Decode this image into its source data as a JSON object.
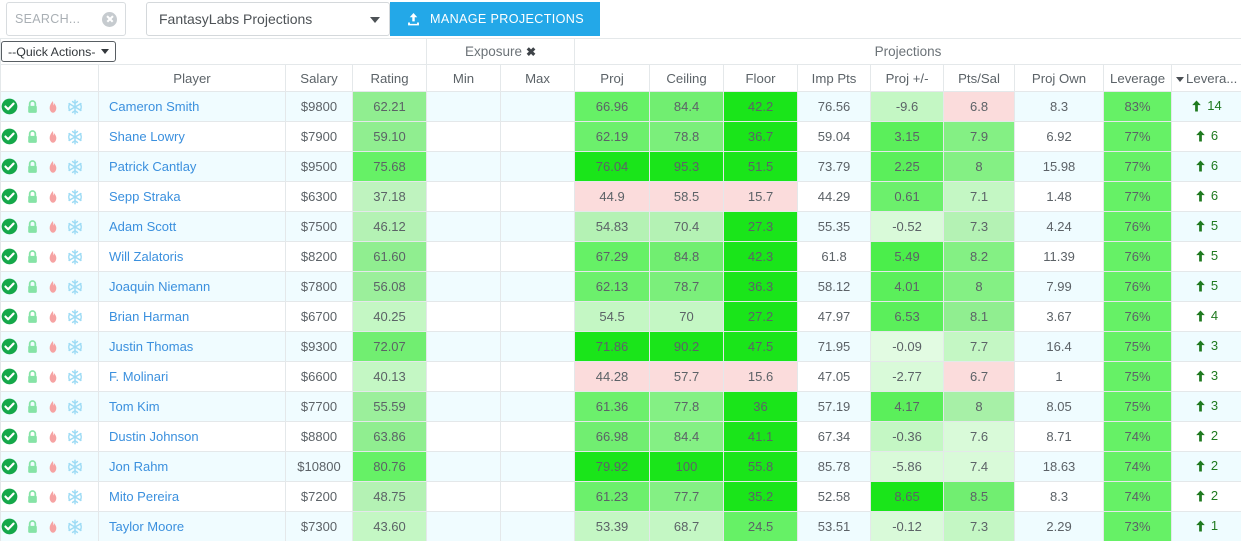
{
  "toolbar": {
    "search_placeholder": "SEARCH...",
    "clear_icon": "clear-circle-icon",
    "projection_source": "FantasyLabs Projections",
    "manage_button": "MANAGE PROJECTIONS",
    "upload_icon": "upload-icon"
  },
  "grid": {
    "quick_actions_label": "--Quick Actions-",
    "group_headers": [
      {
        "label": "Exposure",
        "close": "✖"
      },
      {
        "label": "Projections"
      }
    ],
    "columns": [
      "",
      "Player",
      "Salary",
      "Rating",
      "Min",
      "Max",
      "Proj",
      "Ceiling",
      "Floor",
      "Imp Pts",
      "Proj +/-",
      "Pts/Sal",
      "Proj Own",
      "Leverage",
      "Levera..."
    ],
    "sorted_column": "Levera...",
    "sort_direction": "desc",
    "row_icons": [
      "check-circle-icon",
      "lock-icon",
      "flame-icon",
      "snowflake-icon"
    ],
    "rows": [
      {
        "player": "Cameron Smith",
        "salary": "$9800",
        "rating": "62.21",
        "min": "",
        "max": "",
        "proj": "66.96",
        "ceiling": "84.4",
        "floor": "42.2",
        "imp_pts": "76.56",
        "proj_pm": "-9.6",
        "pts_sal": "6.8",
        "proj_own": "8.3",
        "leverage": "83%",
        "lev_rank": "14",
        "c": {
          "rating": "#90ee90",
          "proj": "#66f166",
          "ceiling": "#71ee71",
          "floor": "#1ae51a",
          "imp_pts": "#effcff",
          "proj_pm": "#c4f7c4",
          "pts_sal": "#fbdcdc",
          "proj_own": "#effcff",
          "leverage": "#66f166",
          "lev_rank": "#effcff"
        }
      },
      {
        "player": "Shane Lowry",
        "salary": "$7900",
        "rating": "59.10",
        "min": "",
        "max": "",
        "proj": "62.19",
        "ceiling": "78.8",
        "floor": "36.7",
        "imp_pts": "59.04",
        "proj_pm": "3.15",
        "pts_sal": "7.9",
        "proj_own": "6.92",
        "leverage": "77%",
        "lev_rank": "6",
        "c": {
          "rating": "#90ee90",
          "proj": "#6cf06c",
          "ceiling": "#7bef7b",
          "floor": "#1ae51a",
          "imp_pts": "#ffffff",
          "proj_pm": "#5bef5b",
          "pts_sal": "#84f084",
          "proj_own": "#ffffff",
          "leverage": "#66f166",
          "lev_rank": "#ffffff"
        }
      },
      {
        "player": "Patrick Cantlay",
        "salary": "$9500",
        "rating": "75.68",
        "min": "",
        "max": "",
        "proj": "76.04",
        "ceiling": "95.3",
        "floor": "51.5",
        "imp_pts": "73.79",
        "proj_pm": "2.25",
        "pts_sal": "8",
        "proj_own": "15.98",
        "leverage": "77%",
        "lev_rank": "6",
        "c": {
          "rating": "#66f166",
          "proj": "#1ae51a",
          "ceiling": "#1ae51a",
          "floor": "#1ae51a",
          "imp_pts": "#effcff",
          "proj_pm": "#5bef5b",
          "pts_sal": "#84f084",
          "proj_own": "#effcff",
          "leverage": "#66f166",
          "lev_rank": "#effcff"
        }
      },
      {
        "player": "Sepp Straka",
        "salary": "$6300",
        "rating": "37.18",
        "min": "",
        "max": "",
        "proj": "44.9",
        "ceiling": "58.5",
        "floor": "15.7",
        "imp_pts": "44.29",
        "proj_pm": "0.61",
        "pts_sal": "7.1",
        "proj_own": "1.48",
        "leverage": "77%",
        "lev_rank": "6",
        "c": {
          "rating": "#bff3bf",
          "proj": "#fbdcdc",
          "ceiling": "#fbdcdc",
          "floor": "#fbdcdc",
          "imp_pts": "#ffffff",
          "proj_pm": "#6cf06c",
          "pts_sal": "#c4f7c4",
          "proj_own": "#ffffff",
          "leverage": "#66f166",
          "lev_rank": "#ffffff"
        }
      },
      {
        "player": "Adam Scott",
        "salary": "$7500",
        "rating": "46.12",
        "min": "",
        "max": "",
        "proj": "54.83",
        "ceiling": "70.4",
        "floor": "27.3",
        "imp_pts": "55.35",
        "proj_pm": "-0.52",
        "pts_sal": "7.3",
        "proj_own": "4.24",
        "leverage": "76%",
        "lev_rank": "5",
        "c": {
          "rating": "#b4f2b4",
          "proj": "#b4f2b4",
          "ceiling": "#b4f2b4",
          "floor": "#1ae51a",
          "imp_pts": "#effcff",
          "proj_pm": "#d9fad9",
          "pts_sal": "#b4f2b4",
          "proj_own": "#effcff",
          "leverage": "#66f166",
          "lev_rank": "#effcff"
        }
      },
      {
        "player": "Will Zalatoris",
        "salary": "$8200",
        "rating": "61.60",
        "min": "",
        "max": "",
        "proj": "67.29",
        "ceiling": "84.8",
        "floor": "42.3",
        "imp_pts": "61.8",
        "proj_pm": "5.49",
        "pts_sal": "8.2",
        "proj_own": "11.39",
        "leverage": "76%",
        "lev_rank": "5",
        "c": {
          "rating": "#90ee90",
          "proj": "#66f166",
          "ceiling": "#71ee71",
          "floor": "#1ae51a",
          "imp_pts": "#ffffff",
          "proj_pm": "#4bee4b",
          "pts_sal": "#84f084",
          "proj_own": "#ffffff",
          "leverage": "#66f166",
          "lev_rank": "#ffffff"
        }
      },
      {
        "player": "Joaquin Niemann",
        "salary": "$7800",
        "rating": "56.08",
        "min": "",
        "max": "",
        "proj": "62.13",
        "ceiling": "78.7",
        "floor": "36.3",
        "imp_pts": "58.12",
        "proj_pm": "4.01",
        "pts_sal": "8",
        "proj_own": "7.99",
        "leverage": "76%",
        "lev_rank": "5",
        "c": {
          "rating": "#9bef9b",
          "proj": "#6cf06c",
          "ceiling": "#7bef7b",
          "floor": "#1ae51a",
          "imp_pts": "#effcff",
          "proj_pm": "#5bef5b",
          "pts_sal": "#84f084",
          "proj_own": "#effcff",
          "leverage": "#66f166",
          "lev_rank": "#effcff"
        }
      },
      {
        "player": "Brian Harman",
        "salary": "$6700",
        "rating": "40.25",
        "min": "",
        "max": "",
        "proj": "54.5",
        "ceiling": "70",
        "floor": "27.2",
        "imp_pts": "47.97",
        "proj_pm": "6.53",
        "pts_sal": "8.1",
        "proj_own": "3.67",
        "leverage": "76%",
        "lev_rank": "4",
        "c": {
          "rating": "#c4f7c4",
          "proj": "#c4f7c4",
          "ceiling": "#c4f7c4",
          "floor": "#1ae51a",
          "imp_pts": "#ffffff",
          "proj_pm": "#5bef5b",
          "pts_sal": "#90ee90",
          "proj_own": "#ffffff",
          "leverage": "#66f166",
          "lev_rank": "#ffffff"
        }
      },
      {
        "player": "Justin Thomas",
        "salary": "$9300",
        "rating": "72.07",
        "min": "",
        "max": "",
        "proj": "71.86",
        "ceiling": "90.2",
        "floor": "47.5",
        "imp_pts": "71.95",
        "proj_pm": "-0.09",
        "pts_sal": "7.7",
        "proj_own": "16.4",
        "leverage": "75%",
        "lev_rank": "3",
        "c": {
          "rating": "#71ee71",
          "proj": "#1ae51a",
          "ceiling": "#1ae51a",
          "floor": "#1ae51a",
          "imp_pts": "#effcff",
          "proj_pm": "#e2fbe2",
          "pts_sal": "#c4f7c4",
          "proj_own": "#effcff",
          "leverage": "#66f166",
          "lev_rank": "#effcff"
        }
      },
      {
        "player": "F. Molinari",
        "salary": "$6600",
        "rating": "40.13",
        "min": "",
        "max": "",
        "proj": "44.28",
        "ceiling": "57.7",
        "floor": "15.6",
        "imp_pts": "47.05",
        "proj_pm": "-2.77",
        "pts_sal": "6.7",
        "proj_own": "1",
        "leverage": "75%",
        "lev_rank": "3",
        "c": {
          "rating": "#c4f7c4",
          "proj": "#fbdcdc",
          "ceiling": "#fbdcdc",
          "floor": "#fbdcdc",
          "imp_pts": "#ffffff",
          "proj_pm": "#d9fad9",
          "pts_sal": "#fbdcdc",
          "proj_own": "#ffffff",
          "leverage": "#66f166",
          "lev_rank": "#ffffff"
        }
      },
      {
        "player": "Tom Kim",
        "salary": "$7700",
        "rating": "55.59",
        "min": "",
        "max": "",
        "proj": "61.36",
        "ceiling": "77.8",
        "floor": "36",
        "imp_pts": "57.19",
        "proj_pm": "4.17",
        "pts_sal": "8",
        "proj_own": "8.05",
        "leverage": "75%",
        "lev_rank": "3",
        "c": {
          "rating": "#9bef9b",
          "proj": "#6cf06c",
          "ceiling": "#84f084",
          "floor": "#1ae51a",
          "imp_pts": "#effcff",
          "proj_pm": "#5bef5b",
          "pts_sal": "#a7f0a7",
          "proj_own": "#effcff",
          "leverage": "#66f166",
          "lev_rank": "#effcff"
        }
      },
      {
        "player": "Dustin Johnson",
        "salary": "$8800",
        "rating": "63.86",
        "min": "",
        "max": "",
        "proj": "66.98",
        "ceiling": "84.4",
        "floor": "41.1",
        "imp_pts": "67.34",
        "proj_pm": "-0.36",
        "pts_sal": "7.6",
        "proj_own": "8.71",
        "leverage": "74%",
        "lev_rank": "2",
        "c": {
          "rating": "#90ee90",
          "proj": "#71ee71",
          "ceiling": "#84f084",
          "floor": "#1ae51a",
          "imp_pts": "#ffffff",
          "proj_pm": "#c4f7c4",
          "pts_sal": "#d9fad9",
          "proj_own": "#ffffff",
          "leverage": "#66f166",
          "lev_rank": "#ffffff"
        }
      },
      {
        "player": "Jon Rahm",
        "salary": "$10800",
        "rating": "80.76",
        "min": "",
        "max": "",
        "proj": "79.92",
        "ceiling": "100",
        "floor": "55.8",
        "imp_pts": "85.78",
        "proj_pm": "-5.86",
        "pts_sal": "7.4",
        "proj_own": "18.63",
        "leverage": "74%",
        "lev_rank": "2",
        "c": {
          "rating": "#66f166",
          "proj": "#1ae51a",
          "ceiling": "#1ae51a",
          "floor": "#1ae51a",
          "imp_pts": "#effcff",
          "proj_pm": "#d9fad9",
          "pts_sal": "#d9fad9",
          "proj_own": "#effcff",
          "leverage": "#66f166",
          "lev_rank": "#effcff"
        }
      },
      {
        "player": "Mito Pereira",
        "salary": "$7200",
        "rating": "48.75",
        "min": "",
        "max": "",
        "proj": "61.23",
        "ceiling": "77.7",
        "floor": "35.2",
        "imp_pts": "52.58",
        "proj_pm": "8.65",
        "pts_sal": "8.5",
        "proj_own": "8.3",
        "leverage": "74%",
        "lev_rank": "2",
        "c": {
          "rating": "#b4f2b4",
          "proj": "#6cf06c",
          "ceiling": "#84f084",
          "floor": "#1ae51a",
          "imp_pts": "#ffffff",
          "proj_pm": "#1ae51a",
          "pts_sal": "#71ee71",
          "proj_own": "#ffffff",
          "leverage": "#66f166",
          "lev_rank": "#ffffff"
        }
      },
      {
        "player": "Taylor Moore",
        "salary": "$7300",
        "rating": "43.60",
        "min": "",
        "max": "",
        "proj": "53.39",
        "ceiling": "68.7",
        "floor": "24.5",
        "imp_pts": "53.51",
        "proj_pm": "-0.12",
        "pts_sal": "7.3",
        "proj_own": "2.29",
        "leverage": "73%",
        "lev_rank": "1",
        "c": {
          "rating": "#c4f7c4",
          "proj": "#c4f7c4",
          "ceiling": "#c4f7c4",
          "floor": "#66f166",
          "imp_pts": "#effcff",
          "proj_pm": "#d9fad9",
          "pts_sal": "#c4f7c4",
          "proj_own": "#effcff",
          "leverage": "#66f166",
          "lev_rank": "#effcff"
        }
      }
    ]
  },
  "colors": {
    "accent_blue": "#23a8e8",
    "link_blue": "#3b90de",
    "bright_green": "#1ae51a",
    "pale_pink": "#fbdcdc",
    "row_tint": "#f0fcff",
    "arrow_green": "#1f7a1f"
  }
}
